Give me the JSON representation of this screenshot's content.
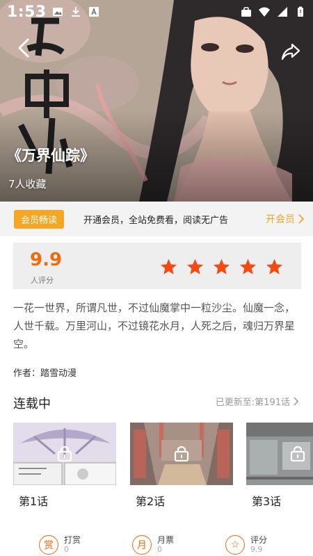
{
  "status_bar": {
    "time": "1:53"
  },
  "hero": {
    "title": "《万界仙踪》",
    "favorites": "7人收藏"
  },
  "vip": {
    "badge": "会员畅读",
    "text": "开通会员，全站免费看，阅读无广告",
    "action": "开会员"
  },
  "rating": {
    "score": "9.9",
    "label": "人评分",
    "stars": 5
  },
  "description": "一花一世界，所谓凡世，不过仙魔掌中一粒沙尘。仙魔一念，人世千载。万里河山，不过镜花水月，人死之后，魂归万界星空。",
  "author": "作者：踏雪动漫",
  "chapters_header": {
    "status": "连载中",
    "updated": "已更新至:第191话"
  },
  "chapters": [
    {
      "label": "第1话",
      "locked": true
    },
    {
      "label": "第2话",
      "locked": true
    },
    {
      "label": "第3话",
      "locked": true
    }
  ],
  "bottom_actions": [
    {
      "icon_char": "赏",
      "label": "打赏",
      "value": "0"
    },
    {
      "icon_char": "月",
      "label": "月票",
      "value": "0"
    },
    {
      "icon_char": "☆",
      "label": "评分",
      "value": "9.9"
    }
  ],
  "colors": {
    "accent": "#f26a0a",
    "vip": "#f5a623"
  }
}
